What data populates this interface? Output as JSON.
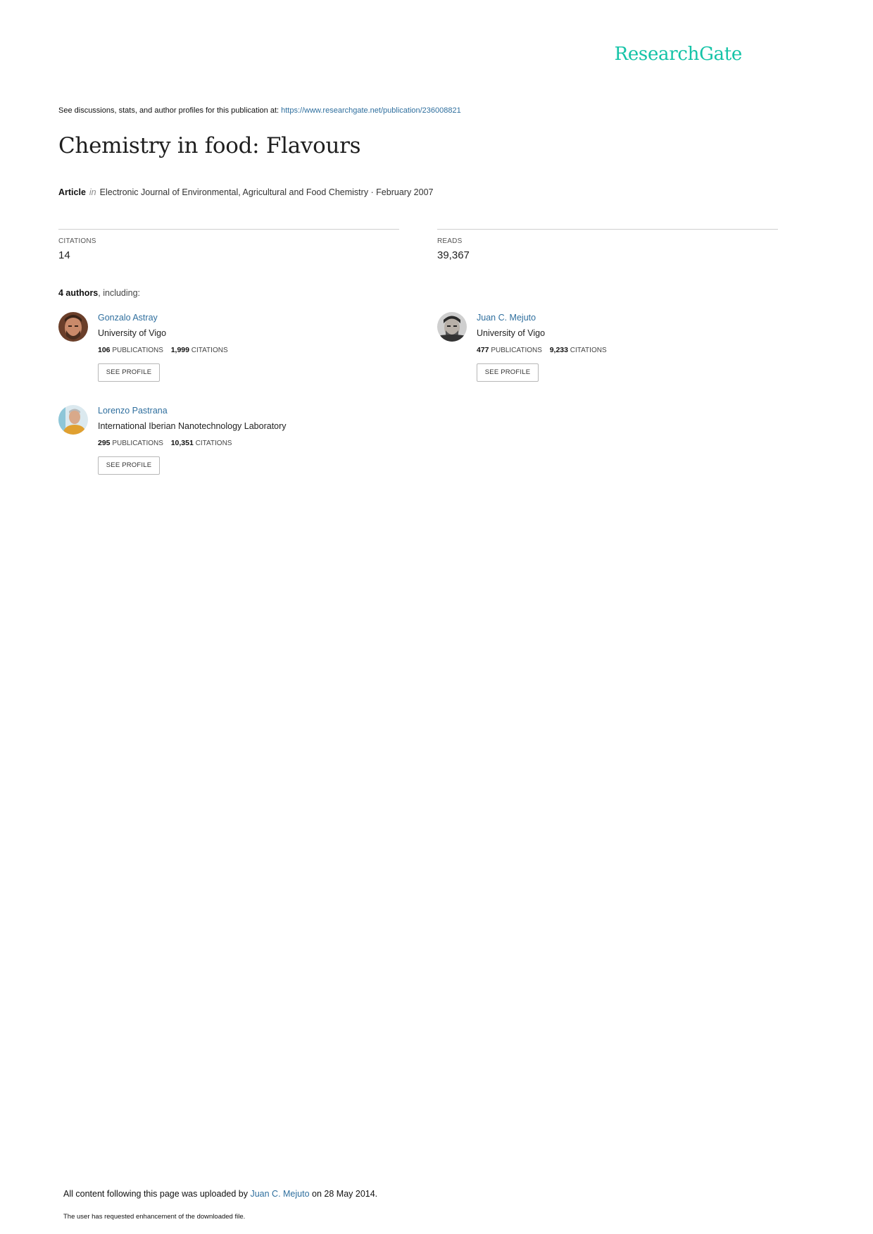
{
  "brand": {
    "logo_text": "ResearchGate",
    "accent_color": "#14c3a7",
    "link_color": "#2f6f9e"
  },
  "header": {
    "see_text": "See discussions, stats, and author profiles for this publication at:",
    "url": "https://www.researchgate.net/publication/236008821"
  },
  "publication": {
    "title": "Chemistry in food: Flavours",
    "type": "Article",
    "in_word": "in",
    "journal_date": "Electronic Journal of Environmental, Agricultural and Food Chemistry · February 2007"
  },
  "stats": {
    "citations": {
      "label": "CITATIONS",
      "value": "14"
    },
    "reads": {
      "label": "READS",
      "value": "39,367"
    }
  },
  "authors_section": {
    "count_label": "4 authors",
    "suffix": ", including:"
  },
  "authors": [
    {
      "name": "Gonzalo Astray",
      "institution": "University of Vigo",
      "publications": "106",
      "publications_label": "PUBLICATIONS",
      "citations": "1,999",
      "citations_label": "CITATIONS",
      "button_label": "SEE PROFILE",
      "avatar_icon": "author-photo"
    },
    {
      "name": "Juan C. Mejuto",
      "institution": "University of Vigo",
      "publications": "477",
      "publications_label": "PUBLICATIONS",
      "citations": "9,233",
      "citations_label": "CITATIONS",
      "button_label": "SEE PROFILE",
      "avatar_icon": "author-photo"
    },
    {
      "name": "Lorenzo Pastrana",
      "institution": "International Iberian Nanotechnology Laboratory",
      "publications": "295",
      "publications_label": "PUBLICATIONS",
      "citations": "10,351",
      "citations_label": "CITATIONS",
      "button_label": "SEE PROFILE",
      "avatar_icon": "author-photo"
    }
  ],
  "footer": {
    "uploaded_prefix": "All content following this page was uploaded by",
    "uploader": "Juan C. Mejuto",
    "uploaded_suffix": "on 28 May 2014.",
    "enhancement_note": "The user has requested enhancement of the downloaded file."
  }
}
